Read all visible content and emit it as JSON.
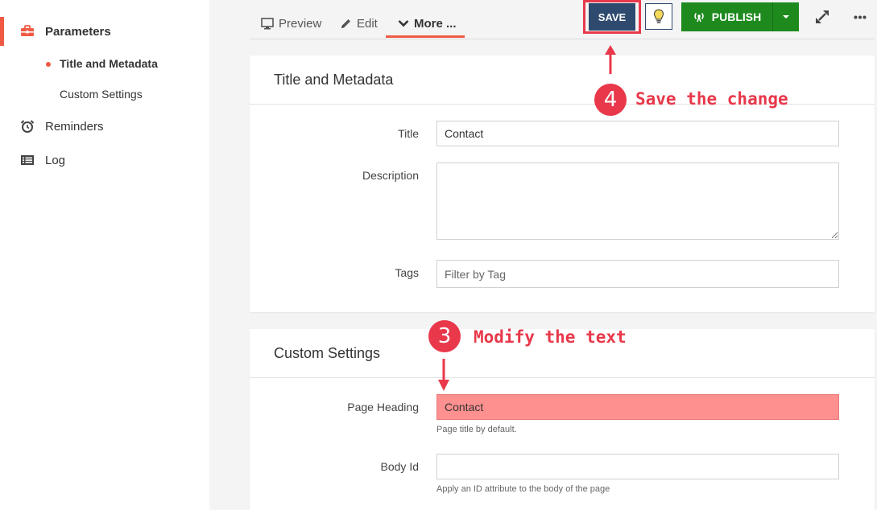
{
  "sidebar": {
    "items": [
      {
        "label": "Parameters",
        "icon": "toolbox-icon"
      },
      {
        "label": "Title and Metadata"
      },
      {
        "label": "Custom Settings"
      },
      {
        "label": "Reminders",
        "icon": "alarm-clock-icon"
      },
      {
        "label": "Log",
        "icon": "list-icon"
      }
    ]
  },
  "toolbar": {
    "tabs": [
      {
        "label": "Preview",
        "icon": "monitor-icon"
      },
      {
        "label": "Edit",
        "icon": "pencil-icon"
      },
      {
        "label": "More ...",
        "icon": "chevron-down-icon"
      }
    ],
    "save_label": "SAVE",
    "publish_label": "PUBLISH",
    "bulb_icon": "lightbulb-icon",
    "expand_icon": "expand-icon",
    "more_icon": "ellipsis-icon"
  },
  "title_panel": {
    "heading": "Title and Metadata",
    "title_label": "Title",
    "title_value": "Contact",
    "description_label": "Description",
    "description_value": "",
    "tags_label": "Tags",
    "tags_placeholder": "Filter by Tag"
  },
  "custom_panel": {
    "heading": "Custom Settings",
    "page_heading_label": "Page Heading",
    "page_heading_value": "Contact",
    "page_heading_help": "Page title by default.",
    "body_id_label": "Body Id",
    "body_id_value": "",
    "body_id_help": "Apply an ID attribute to the body of the page"
  },
  "annotations": {
    "step4_number": "4",
    "step4_text": "Save the change",
    "step3_number": "3",
    "step3_text": "Modify the text"
  },
  "colors": {
    "accent": "#f05a44",
    "save": "#2e4a6e",
    "publish": "#1e8a1e",
    "annotation": "#e8384a",
    "highlight_field": "#ff9090"
  }
}
